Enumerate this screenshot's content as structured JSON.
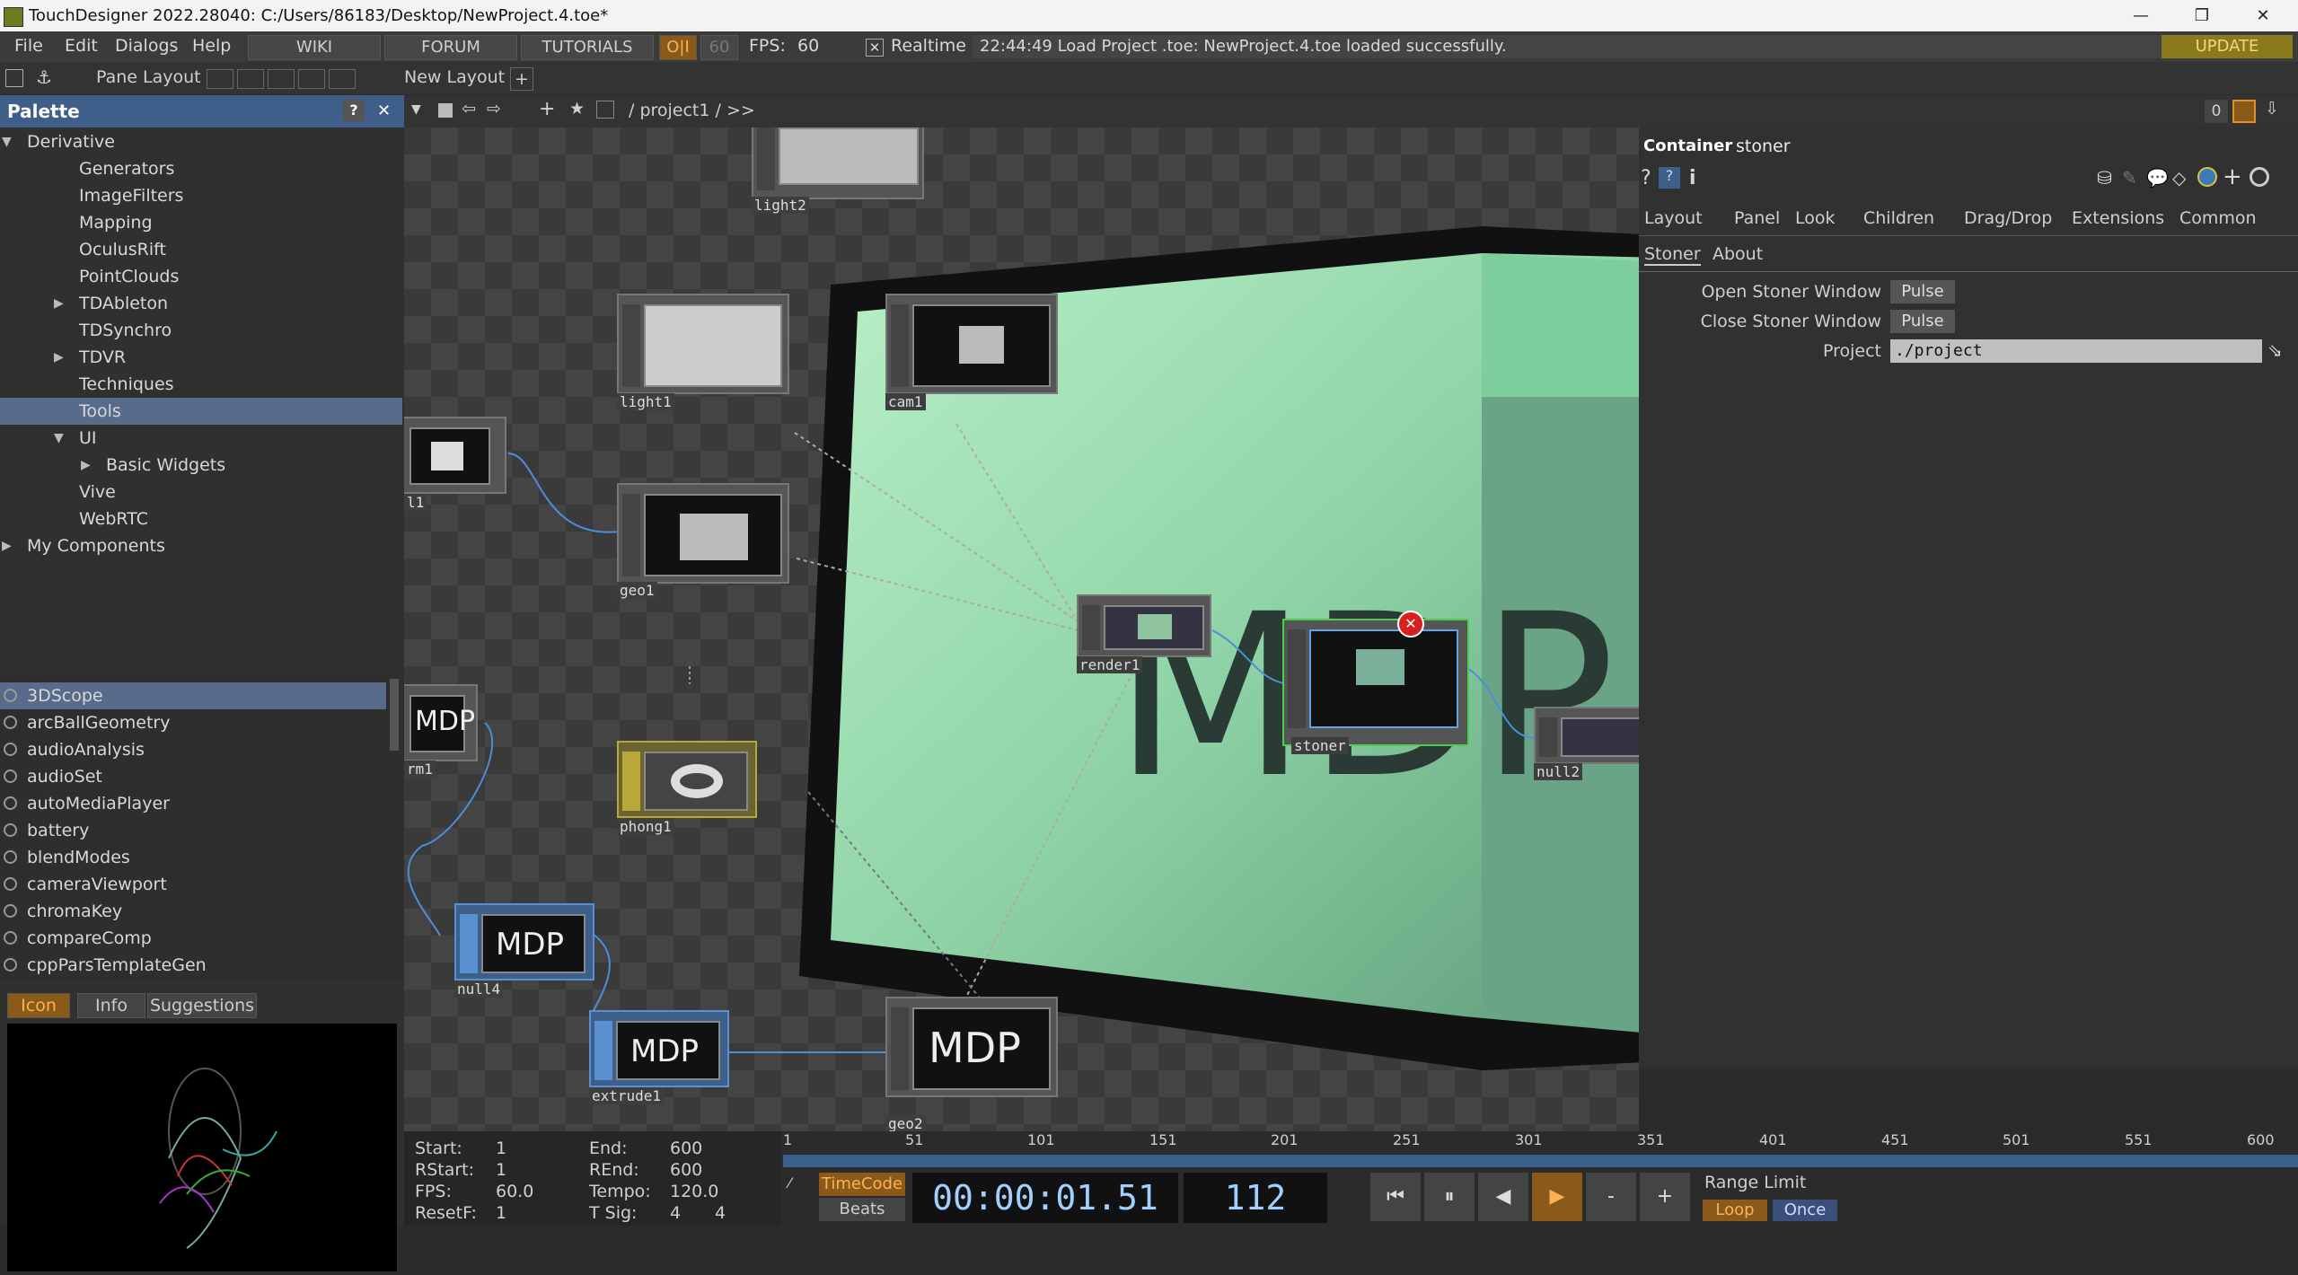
{
  "window": {
    "title": "TouchDesigner 2022.28040: C:/Users/86183/Desktop/NewProject.4.toe*",
    "controls": [
      "—",
      "❐",
      "✕"
    ]
  },
  "menubar": {
    "items": [
      "File",
      "Edit",
      "Dialogs",
      "Help"
    ],
    "wiki": "WIKI",
    "forum": "FORUM",
    "tutorials": "TUTORIALS",
    "oi": "O|I",
    "fps_target": "60",
    "fps_label": "FPS:",
    "fps_value": "60",
    "realtime_label": "Realtime",
    "status_message": "22:44:49 Load Project .toe: NewProject.4.toe loaded successfully.",
    "update": "UPDATE"
  },
  "panebar": {
    "pane_layout": "Pane Layout",
    "new_layout": "New Layout"
  },
  "palette": {
    "title": "Palette",
    "tree": [
      {
        "label": "Derivative",
        "indent": 0,
        "arrow": "down"
      },
      {
        "label": "Generators",
        "indent": 1,
        "arrow": ""
      },
      {
        "label": "ImageFilters",
        "indent": 1,
        "arrow": ""
      },
      {
        "label": "Mapping",
        "indent": 1,
        "arrow": ""
      },
      {
        "label": "OculusRift",
        "indent": 1,
        "arrow": ""
      },
      {
        "label": "PointClouds",
        "indent": 1,
        "arrow": ""
      },
      {
        "label": "TDAbleton",
        "indent": 1,
        "arrow": "right"
      },
      {
        "label": "TDSynchro",
        "indent": 1,
        "arrow": ""
      },
      {
        "label": "TDVR",
        "indent": 1,
        "arrow": "right"
      },
      {
        "label": "Techniques",
        "indent": 1,
        "arrow": ""
      },
      {
        "label": "Tools",
        "indent": 1,
        "arrow": "",
        "selected": true
      },
      {
        "label": "UI",
        "indent": 1,
        "arrow": "down"
      },
      {
        "label": "Basic Widgets",
        "indent": 2,
        "arrow": "right"
      },
      {
        "label": "Vive",
        "indent": 1,
        "arrow": ""
      },
      {
        "label": "WebRTC",
        "indent": 1,
        "arrow": ""
      },
      {
        "label": "My Components",
        "indent": 0,
        "arrow": "right"
      }
    ],
    "components": [
      {
        "label": "3DScope",
        "selected": true
      },
      {
        "label": "arcBallGeometry"
      },
      {
        "label": "audioAnalysis"
      },
      {
        "label": "audioSet"
      },
      {
        "label": "autoMediaPlayer"
      },
      {
        "label": "battery"
      },
      {
        "label": "blendModes"
      },
      {
        "label": "cameraViewport"
      },
      {
        "label": "chromaKey"
      },
      {
        "label": "compareComp"
      },
      {
        "label": "cppParsTemplateGen"
      }
    ],
    "tabs": [
      "Icon",
      "Info",
      "Suggestions"
    ]
  },
  "network": {
    "path": "/ project1 / >>",
    "counter": "0",
    "nodes": {
      "light2": "light2",
      "light1": "light1",
      "cam1": "cam1",
      "geo1": "geo1",
      "render1": "render1",
      "stoner": "stoner",
      "null2": "null2",
      "phong1": "phong1",
      "null4": "null4",
      "extrude1": "extrude1",
      "geo2": "geo2",
      "left_partial_1": "l1",
      "left_partial_2": "rm1"
    },
    "mdp_text": "MDP"
  },
  "params": {
    "op_type": "Container",
    "op_name": "stoner",
    "page_tabs": [
      "Layout",
      "Panel",
      "Look",
      "Children",
      "Drag/Drop",
      "Extensions",
      "Common"
    ],
    "custom_tabs": [
      "Stoner",
      "About"
    ],
    "rows": [
      {
        "label": "Open Stoner Window",
        "button": "Pulse"
      },
      {
        "label": "Close Stoner Window",
        "button": "Pulse"
      }
    ],
    "project_label": "Project",
    "project_value": "./project"
  },
  "timeline": {
    "start_label": "Start:",
    "start": "1",
    "end_label": "End:",
    "end": "600",
    "rstart_label": "RStart:",
    "rstart": "1",
    "rend_label": "REnd:",
    "rend": "600",
    "fps_label": "FPS:",
    "fps": "60.0",
    "tempo_label": "Tempo:",
    "tempo": "120.0",
    "resetf_label": "ResetF:",
    "resetf": "1",
    "tsig_label": "T Sig:",
    "tsig_a": "4",
    "tsig_b": "4",
    "ticks": [
      "1",
      "51",
      "101",
      "151",
      "201",
      "251",
      "301",
      "351",
      "401",
      "451",
      "501",
      "551",
      "600"
    ],
    "timecode_btn": "TimeCode",
    "beats_btn": "Beats",
    "timecode": "00:00:01.51",
    "frame": "112",
    "minus": "-",
    "plus": "+",
    "range_limit": "Range Limit",
    "loop": "Loop",
    "once": "Once"
  },
  "colors": {
    "accent": "#e0902a",
    "selection": "#586b8a",
    "palette_header": "#3f5f8a"
  }
}
